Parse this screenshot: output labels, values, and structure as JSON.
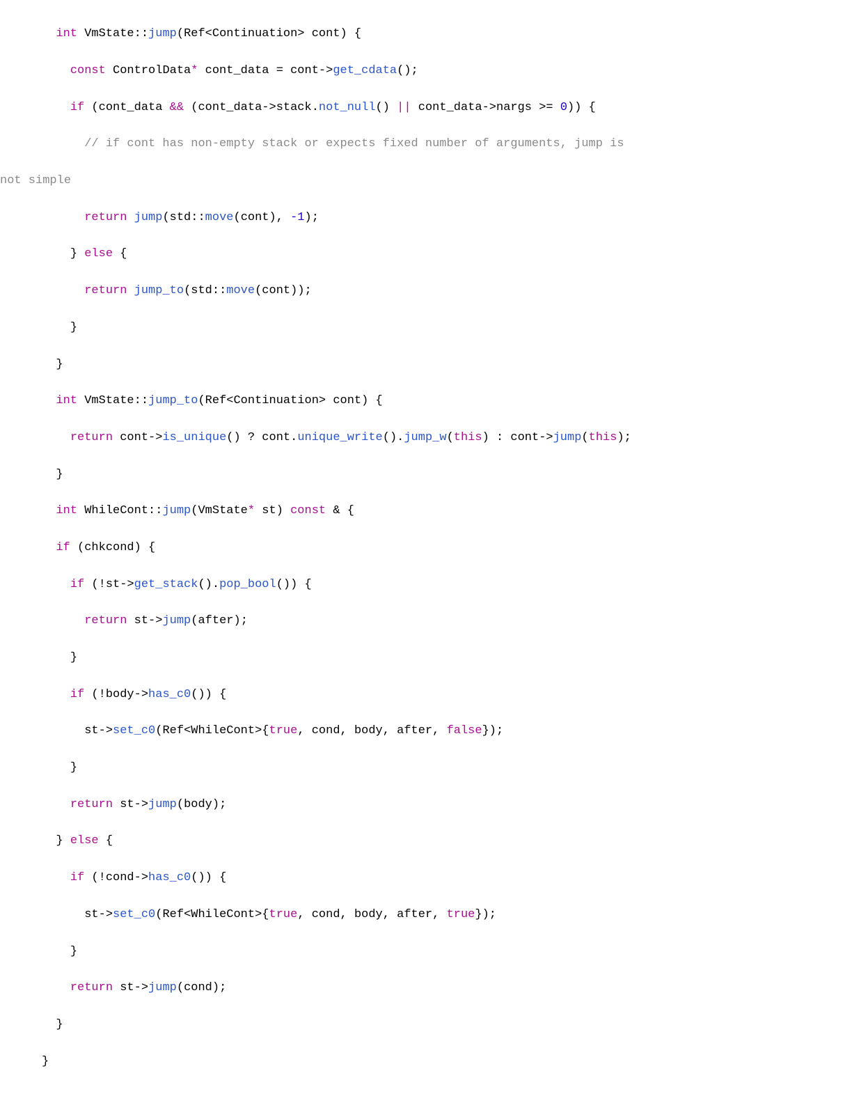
{
  "code": {
    "indent": "  ",
    "tokens": {
      "kw_int": "int",
      "kw_const": "const",
      "kw_if": "if",
      "kw_else": "else",
      "kw_return": "return",
      "kw_true": "true",
      "kw_false": "false",
      "kw_this": "this",
      "cls_VmState": "VmState",
      "cls_WhileCont": "WhileCont",
      "cls_ControlData": "ControlData",
      "cls_Ref": "Ref",
      "cls_Continuation": "Continuation",
      "id_cont": "cont",
      "id_cont_data": "cont_data",
      "id_stack": "stack",
      "id_nargs": "nargs",
      "id_std": "std",
      "id_st": "st",
      "id_chkcond": "chkcond",
      "id_body": "body",
      "id_cond": "cond",
      "id_after": "after",
      "fn_jump": "jump",
      "fn_jump_to": "jump_to",
      "fn_get_cdata": "get_cdata",
      "fn_not_null": "not_null",
      "fn_move": "move",
      "fn_is_unique": "is_unique",
      "fn_unique_write": "unique_write",
      "fn_jump_w": "jump_w",
      "fn_get_stack": "get_stack",
      "fn_pop_bool": "pop_bool",
      "fn_has_c0": "has_c0",
      "fn_set_c0": "set_c0",
      "num_neg1": "-1",
      "num_0": "0",
      "op_scope": "::",
      "op_arrow": "->",
      "op_dot": ".",
      "op_and": "&&",
      "op_or": "||",
      "op_not": "!",
      "op_ge": ">=",
      "op_q": "?",
      "op_colon": ":",
      "op_amp": "&",
      "p_lbrace": "{",
      "p_rbrace": "}",
      "p_lparen": "(",
      "p_rparen": ")",
      "p_lt": "<",
      "p_gt": ">",
      "p_comma": ",",
      "p_semi": ";",
      "p_eq": "=",
      "p_star": "*",
      "comment_line1": "// if cont has non-empty stack or expects fixed number of arguments, jump is",
      "comment_line2": "not simple"
    }
  }
}
